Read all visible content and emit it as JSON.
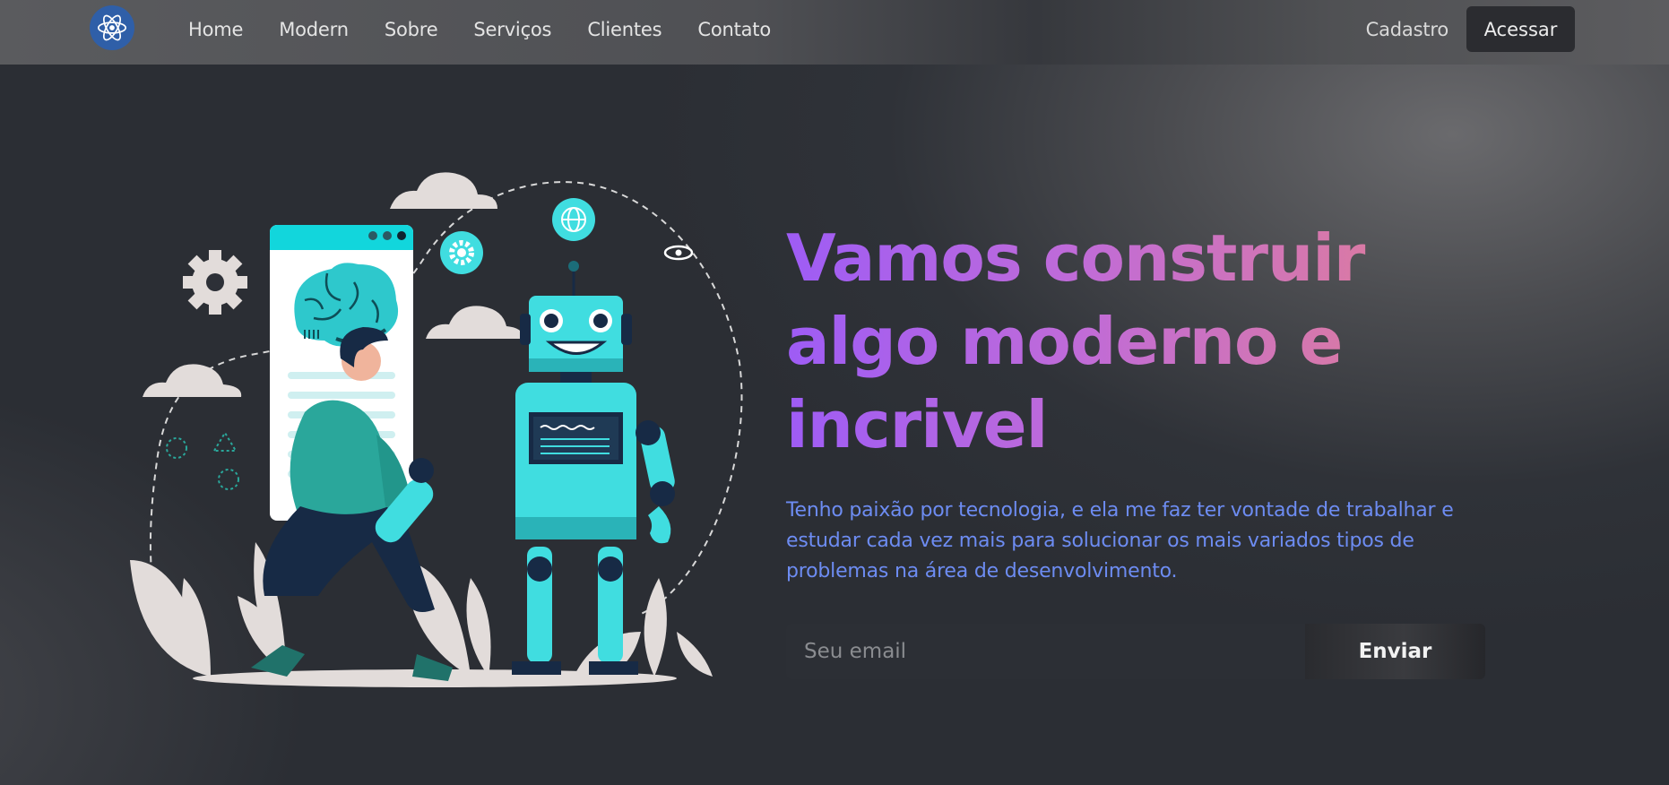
{
  "brand": {
    "logo_icon": "react-atom-icon",
    "logo_color": "#2f5fa8"
  },
  "nav": {
    "links": [
      {
        "label": "Home"
      },
      {
        "label": "Modern"
      },
      {
        "label": "Sobre"
      },
      {
        "label": "Serviços"
      },
      {
        "label": "Clientes"
      },
      {
        "label": "Contato"
      }
    ],
    "signup_label": "Cadastro",
    "login_label": "Acessar"
  },
  "hero": {
    "title": "Vamos construir algo moderno e incrivel",
    "description": "Tenho paixão por tecnologia, e ela me faz ter vontade de trabalhar e estudar cada vez mais para solucionar os mais variados tipos de problemas na área de desenvolvimento.",
    "illustration": "developer-with-robot-illustration"
  },
  "subscribe": {
    "email_placeholder": "Seu email",
    "email_value": "",
    "submit_label": "Enviar"
  },
  "colors": {
    "title_gradient_start": "#9e5cf5",
    "title_gradient_end": "#df7d9a",
    "description": "#6d8cf2",
    "robot": "#40dde0",
    "background": "#2b2e34"
  }
}
